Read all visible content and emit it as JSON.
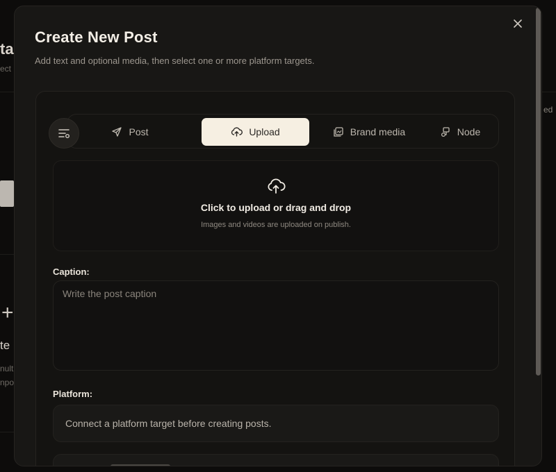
{
  "background": {
    "heading_fragment": "ta",
    "sub_fragment": "ect",
    "right_fragment": "ed",
    "plus_glyph": "+",
    "card_title_fragment": "te",
    "card_sub1_fragment": "nult",
    "card_sub2_fragment": "npo"
  },
  "modal": {
    "title": "Create New Post",
    "subtitle": "Add text and optional media, then select one or more platform targets.",
    "close_glyph": "×",
    "tabs": [
      {
        "label": "Post",
        "icon": "send-icon",
        "active": false
      },
      {
        "label": "Upload",
        "icon": "cloud-upload-icon",
        "active": true
      },
      {
        "label": "Brand media",
        "icon": "gallery-icon",
        "active": false
      },
      {
        "label": "Node",
        "icon": "node-icon",
        "active": false
      }
    ],
    "dropzone": {
      "title": "Click to upload or drag and drop",
      "subtitle": "Images and videos are uploaded on publish."
    },
    "caption": {
      "label": "Caption:",
      "placeholder": "Write the post caption",
      "value": ""
    },
    "platform": {
      "label": "Platform:",
      "message": "Connect a platform target before creating posts."
    }
  },
  "colors": {
    "modal_bg": "#181715",
    "active_tab_bg": "#f6efe2",
    "accent_text": "#f1ece4"
  }
}
